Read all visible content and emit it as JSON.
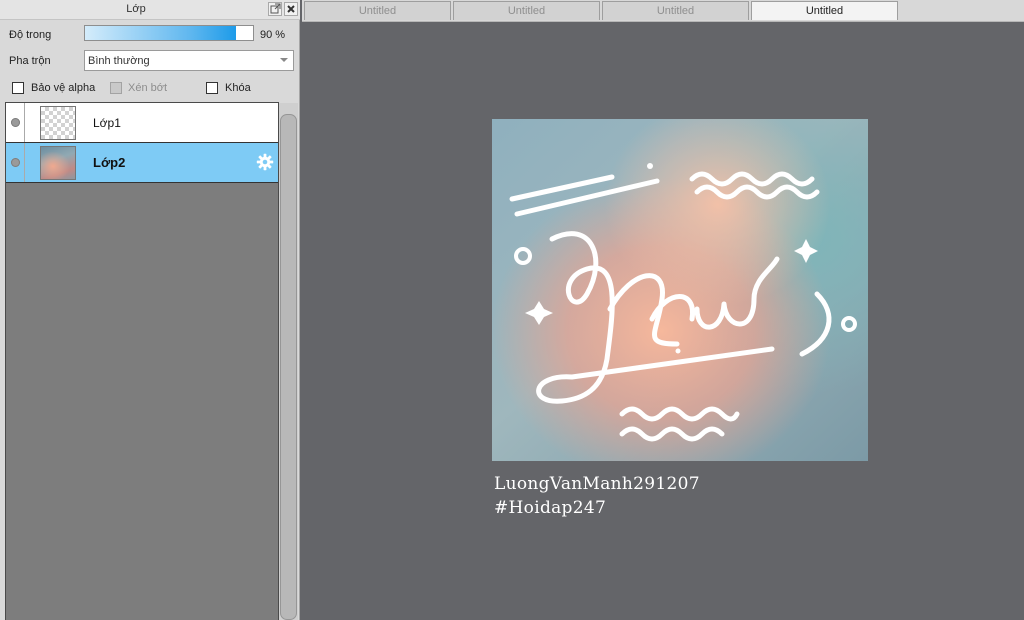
{
  "panel": {
    "title": "Lớp",
    "opacity_label": "Độ trong",
    "opacity_value_text": "90 %",
    "opacity_percent": 90,
    "blend_label": "Pha trộn",
    "blend_mode": "Bình thường",
    "options": [
      {
        "label": "Bảo vệ alpha",
        "checked": false,
        "enabled": true
      },
      {
        "label": "Xén bớt",
        "checked": false,
        "enabled": false
      },
      {
        "label": "Khóa",
        "checked": false,
        "enabled": true
      }
    ],
    "layers": [
      {
        "name": "Lớp1",
        "selected": false
      },
      {
        "name": "Lớp2",
        "selected": true
      }
    ]
  },
  "tabs": [
    {
      "label": "Untitled",
      "active": false
    },
    {
      "label": "Untitled",
      "active": false
    },
    {
      "label": "Untitled",
      "active": false
    },
    {
      "label": "Untitled",
      "active": true
    }
  ],
  "canvas": {
    "artwork_word": "New",
    "caption_line1": "LuongVanManh291207",
    "caption_line2": "#Hoidap247"
  },
  "colors": {
    "selection": "#7ecbf5",
    "canvas_bg": "#646569",
    "opacity_fill": "#1d9be9"
  },
  "icons": {
    "popout": "popout-icon",
    "close": "close-icon",
    "visibility": "visibility-dot-icon",
    "layer_settings": "gear-icon"
  }
}
